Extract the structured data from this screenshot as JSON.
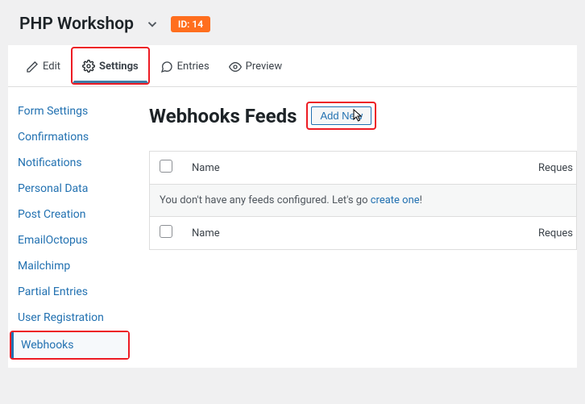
{
  "header": {
    "title": "PHP Workshop",
    "id_badge": "ID: 14"
  },
  "tabs": {
    "edit": "Edit",
    "settings": "Settings",
    "entries": "Entries",
    "preview": "Preview"
  },
  "sidebar": {
    "items": [
      "Form Settings",
      "Confirmations",
      "Notifications",
      "Personal Data",
      "Post Creation",
      "EmailOctopus",
      "Mailchimp",
      "Partial Entries",
      "User Registration",
      "Webhooks"
    ]
  },
  "main": {
    "title": "Webhooks Feeds",
    "add_new_label": "Add New",
    "col_name": "Name",
    "col_request": "Reques",
    "empty_prefix": "You don't have any feeds configured. Let's go ",
    "empty_link": "create one",
    "empty_suffix": "!"
  }
}
